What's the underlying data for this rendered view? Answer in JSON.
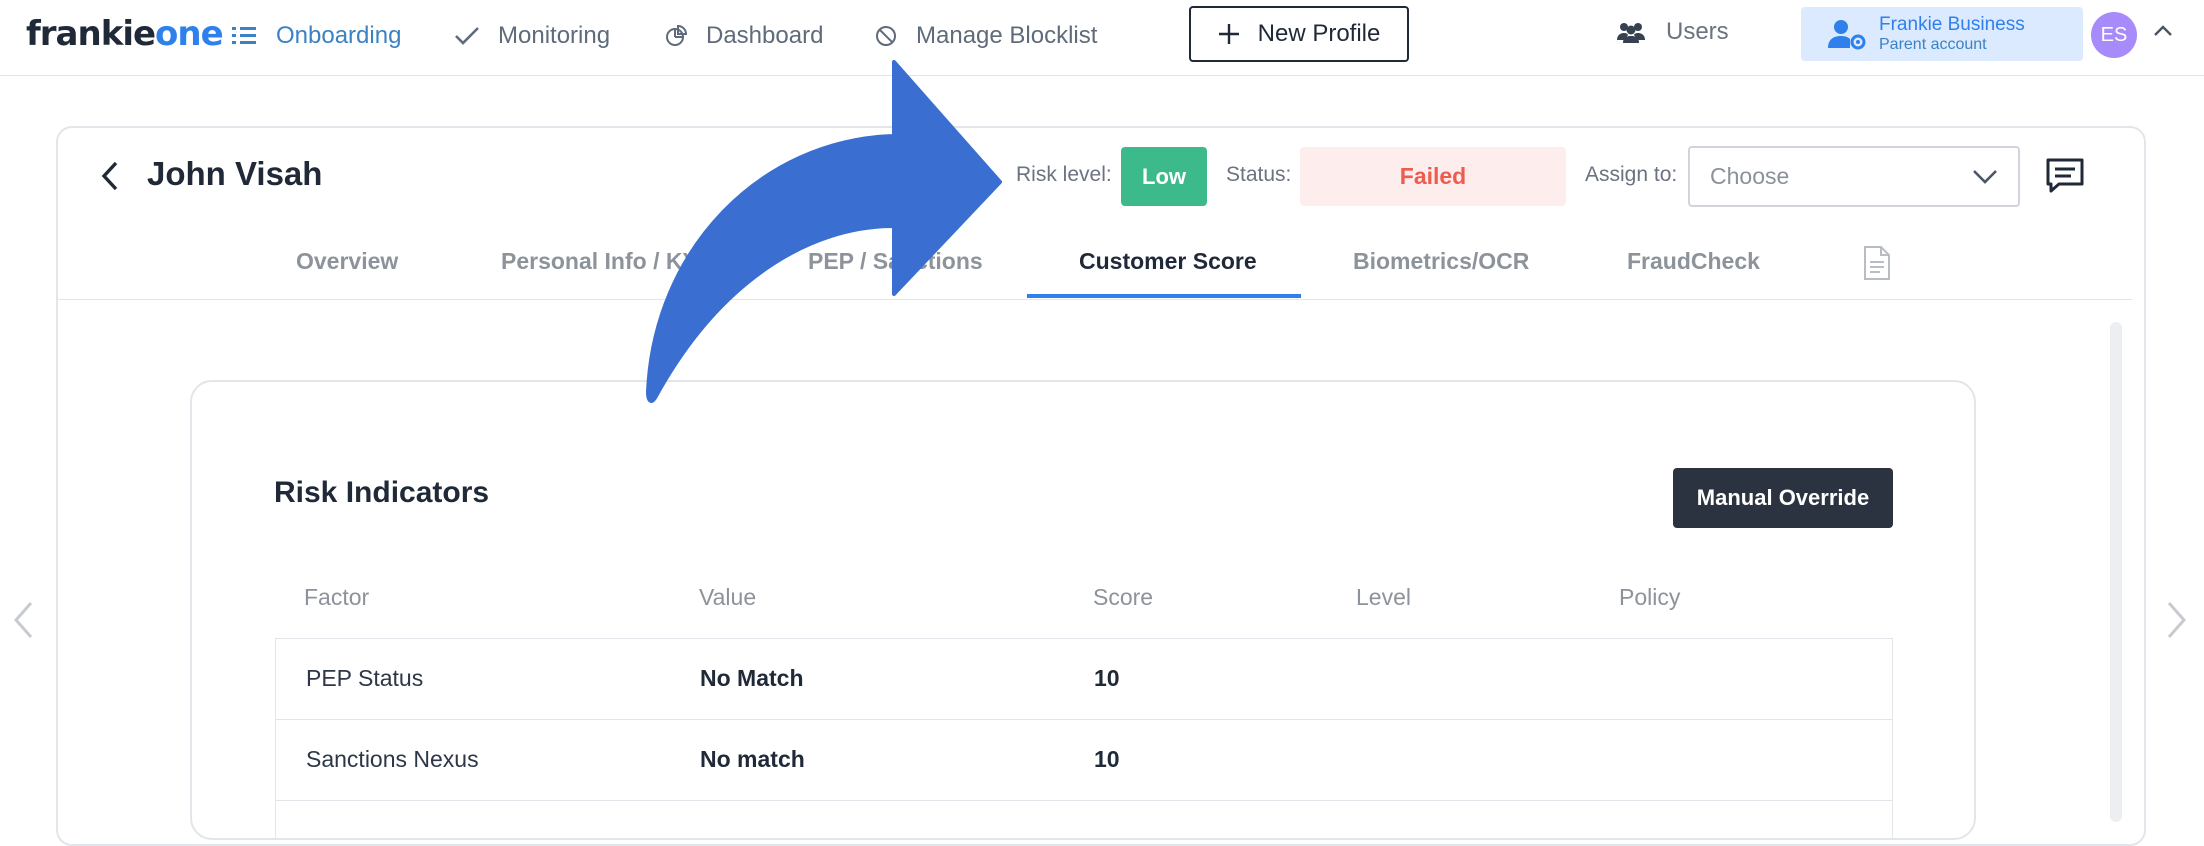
{
  "nav": {
    "logo_main": "frankie",
    "logo_accent": "one",
    "items": [
      {
        "label": "Onboarding"
      },
      {
        "label": "Monitoring"
      },
      {
        "label": "Dashboard"
      },
      {
        "label": "Manage Blocklist"
      }
    ],
    "new_profile": "New Profile",
    "users": "Users",
    "account_name": "Frankie Business",
    "account_type": "Parent account",
    "avatar_initials": "ES"
  },
  "profile": {
    "name": "John Visah",
    "risk_label": "Risk level:",
    "risk_value": "Low",
    "status_label": "Status:",
    "status_value": "Failed",
    "assign_label": "Assign to:",
    "assign_placeholder": "Choose"
  },
  "tabs": [
    {
      "label": "Overview"
    },
    {
      "label": "Personal Info / KYC"
    },
    {
      "label": "PEP / Sanctions"
    },
    {
      "label": "Customer Score"
    },
    {
      "label": "Biometrics/OCR"
    },
    {
      "label": "FraudCheck"
    }
  ],
  "risk": {
    "title": "Risk Indicators",
    "override": "Manual Override",
    "columns": [
      "Factor",
      "Value",
      "Score",
      "Level",
      "Policy"
    ],
    "rows": [
      {
        "factor": "PEP Status",
        "value": "No Match",
        "score": "10",
        "level": "",
        "policy": ""
      },
      {
        "factor": "Sanctions Nexus",
        "value": "No match",
        "score": "10",
        "level": "",
        "policy": ""
      }
    ]
  },
  "colors": {
    "accent": "#2f80ed",
    "risk_low": "#3dba8b",
    "failed_text": "#ef5b4f",
    "failed_bg": "#fdeeed",
    "annotation_arrow": "#3a6fd1"
  }
}
